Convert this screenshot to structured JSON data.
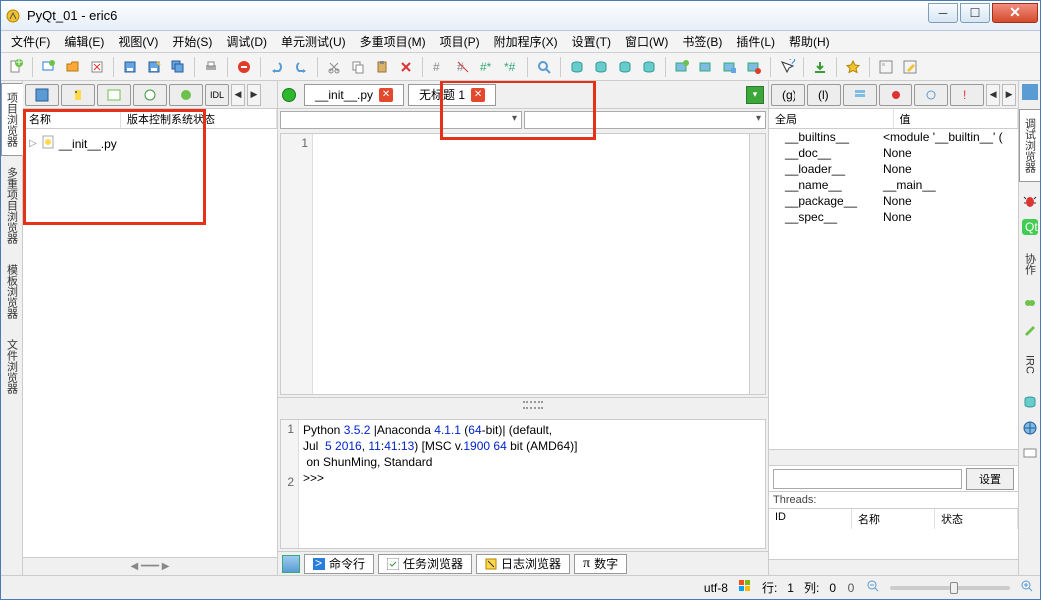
{
  "window": {
    "title": "PyQt_01 - eric6"
  },
  "menu": {
    "file": "文件(F)",
    "edit": "编辑(E)",
    "view": "视图(V)",
    "start": "开始(S)",
    "debug": "调试(D)",
    "unittest": "单元测试(U)",
    "multiproject": "多重项目(M)",
    "project": "项目(P)",
    "addons": "附加程序(X)",
    "settings": "设置(T)",
    "window": "窗口(W)",
    "bookmark": "书签(B)",
    "plugins": "插件(L)",
    "help": "帮助(H)"
  },
  "left_tabs": {
    "project": "项目浏览器",
    "multi": "多重项目浏览器",
    "template": "模板浏览器",
    "file": "文件浏览器"
  },
  "tree": {
    "col_name": "名称",
    "col_vcs": "版本控制系统状态",
    "item0": "__init__.py"
  },
  "editor": {
    "tab1": "__init__.py",
    "tab2": "无标题 1",
    "line1": "1"
  },
  "console": {
    "l1": "1",
    "l2": "2",
    "text": "Python 3.5.2 |Anaconda 4.1.1 (64-bit)| (default,\nJul  5 2016, 11:41:13) [MSC v.1900 64 bit (AMD64)]\n on ShunMing, Standard\n>>> "
  },
  "bottom_tabs": {
    "cmd": "命令行",
    "task": "任务浏览器",
    "log": "日志浏览器",
    "num": "数字"
  },
  "vars": {
    "h_global": "全局",
    "h_value": "值",
    "r0n": "__builtins__",
    "r0v": "<module '__builtin__' (",
    "r1n": "__doc__",
    "r1v": "None",
    "r2n": "__loader__",
    "r2v": "None",
    "r3n": "__name__",
    "r3v": "__main__",
    "r4n": "__package__",
    "r4v": "None",
    "r5n": "__spec__",
    "r5v": "None",
    "settings_btn": "设置"
  },
  "threads": {
    "label": "Threads:",
    "id": "ID",
    "name": "名称",
    "state": "状态"
  },
  "right_tabs": {
    "debug": "调试浏览器",
    "coop": "协作",
    "irc": "IRC"
  },
  "status": {
    "encoding": "utf-8",
    "line_lbl": "行:",
    "line": "1",
    "col_lbl": "列:",
    "col": "0",
    "zoom": "0"
  }
}
